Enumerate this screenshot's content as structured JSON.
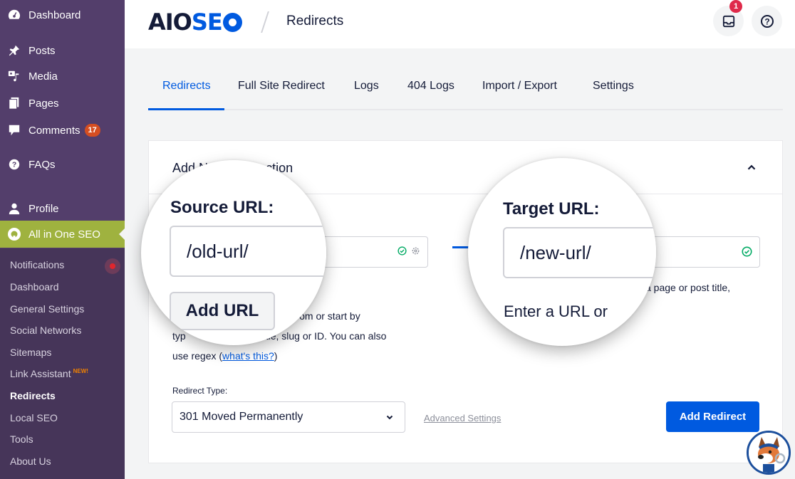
{
  "sidebar": {
    "menu": [
      {
        "label": "Dashboard",
        "icon": "dashboard-icon"
      },
      {
        "label": "Posts",
        "icon": "pin-icon"
      },
      {
        "label": "Media",
        "icon": "media-icon"
      },
      {
        "label": "Pages",
        "icon": "pages-icon"
      },
      {
        "label": "Comments",
        "icon": "comment-icon",
        "badge": "17"
      },
      {
        "label": "FAQs",
        "icon": "question-icon"
      },
      {
        "label": "Profile",
        "icon": "user-icon"
      },
      {
        "label": "All in One SEO",
        "icon": "aioseo-icon",
        "active": true
      }
    ],
    "submenu": [
      {
        "label": "Notifications"
      },
      {
        "label": "Dashboard"
      },
      {
        "label": "General Settings"
      },
      {
        "label": "Social Networks"
      },
      {
        "label": "Sitemaps"
      },
      {
        "label": "Link Assistant",
        "tag": "NEW!"
      },
      {
        "label": "Redirects",
        "current": true
      },
      {
        "label": "Local SEO"
      },
      {
        "label": "Tools"
      },
      {
        "label": "About Us"
      }
    ]
  },
  "header": {
    "logo_aio": "AIO",
    "logo_seo": "SE",
    "title": "Redirects",
    "inbox_badge": "1"
  },
  "tabs": [
    {
      "label": "Redirects",
      "active": true
    },
    {
      "label": "Full Site Redirect"
    },
    {
      "label": "Logs"
    },
    {
      "label": "404 Logs"
    },
    {
      "label": "Import / Export"
    },
    {
      "label": "Settings"
    }
  ],
  "card": {
    "title": "Add New Redirection",
    "source": {
      "label": "Source URL:",
      "value": "/old-url/",
      "add_url_label": "Add URL",
      "help_visible_1": "ect from or start by",
      "help_visible_2": "title, slug or ID. You can also",
      "help_prefix_2": "typ",
      "help_3": "use regex (",
      "help_link": "what's this?",
      "help_suffix": ")"
    },
    "target": {
      "label": "Target URL:",
      "value": "/new-url/",
      "help_visible": "a page or post title,",
      "help_magnified": "Enter a URL or"
    },
    "redirect_type_label": "Redirect Type:",
    "redirect_type_value": "301 Moved Permanently",
    "advanced_settings": "Advanced Settings",
    "add_redirect": "Add Redirect"
  },
  "colors": {
    "accent": "#005ae0",
    "sidebar": "#533e6b",
    "sidebar_active": "#9fb23f",
    "success": "#00aa63"
  }
}
